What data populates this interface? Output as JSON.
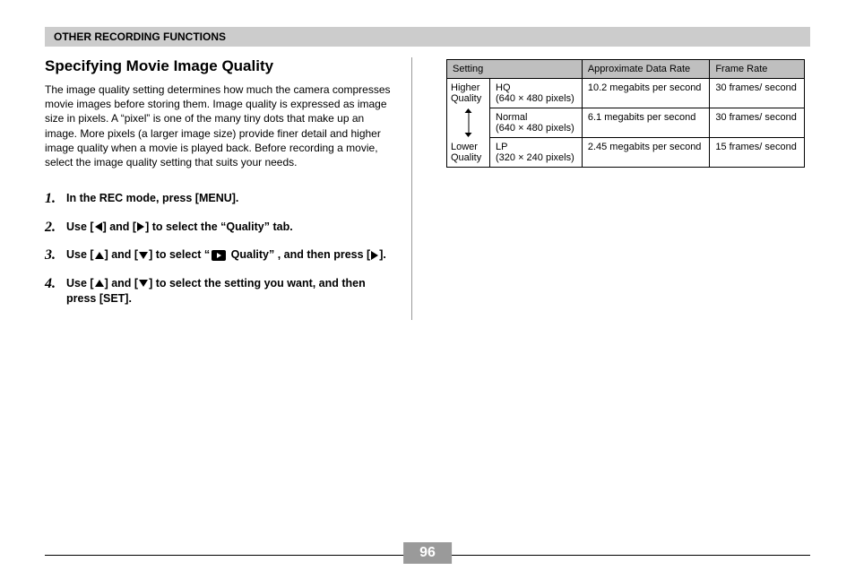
{
  "section_header": "OTHER RECORDING FUNCTIONS",
  "title": "Specifying Movie Image Quality",
  "intro": "The image quality setting determines how much the camera compresses movie images before storing them. Image quality is expressed as image size in pixels. A “pixel” is one of the many tiny dots that make up an image. More pixels (a larger image size) provide finer detail and higher image quality when a movie is played back. Before recording a movie, select the image quality setting that suits your needs.",
  "steps": {
    "s1": "In the REC mode, press [MENU].",
    "s2_a": "Use [",
    "s2_b": "] and [",
    "s2_c": "] to select the “Quality” tab.",
    "s3_a": "Use [",
    "s3_b": "] and [",
    "s3_c": "] to select “",
    "s3_d": " Quality” , and then press [",
    "s3_e": "].",
    "s4_a": "Use [",
    "s4_b": "] and [",
    "s4_c": "] to select the setting you want, and then press [SET]."
  },
  "table": {
    "headers": {
      "setting": "Setting",
      "rate": "Approximate Data Rate",
      "fps": "Frame Rate"
    },
    "side": {
      "top": "Higher Quality",
      "bottom": "Lower Quality"
    },
    "rows": [
      {
        "name": "HQ",
        "pixels": "(640 × 480 pixels)",
        "rate": "10.2 megabits per second",
        "fps": "30 frames/ second"
      },
      {
        "name": "Normal",
        "pixels": "(640 × 480 pixels)",
        "rate": "6.1 megabits per second",
        "fps": "30 frames/ second"
      },
      {
        "name": "LP",
        "pixels": "(320 × 240 pixels)",
        "rate": "2.45 megabits per second",
        "fps": "15 frames/ second"
      }
    ]
  },
  "page_number": "96"
}
